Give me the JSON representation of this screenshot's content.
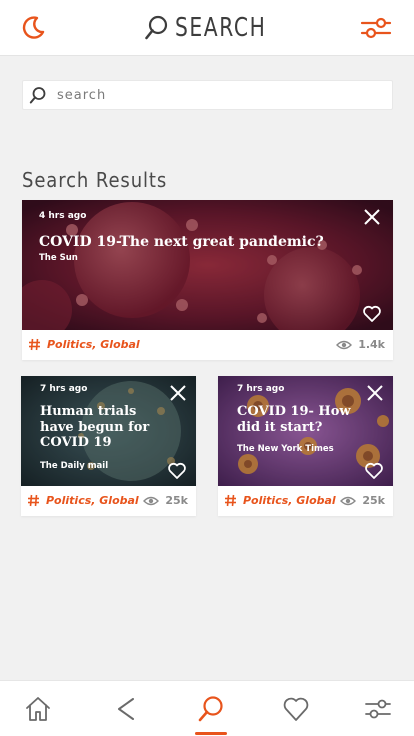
{
  "header": {
    "title": "SEARCH"
  },
  "search": {
    "placeholder": "search"
  },
  "results_title": "Search Results",
  "colors": {
    "accent": "#e8541c",
    "text": "#3d3d3d",
    "background": "#f1f1f1"
  },
  "cards": [
    {
      "time": "4 hrs ago",
      "title": "COVID 19-The next great pandemic?",
      "source": "The Sun",
      "tags": "Politics, Global",
      "views": "1.4k"
    },
    {
      "time": "7 hrs ago",
      "title_lines": [
        "Human trials",
        "have begun for",
        "COVID 19"
      ],
      "source": "The Daily mail",
      "tags": "Politics, Global",
      "views": "25k"
    },
    {
      "time": "7 hrs ago",
      "title_lines": [
        "COVID 19- How",
        "did it start?"
      ],
      "source": "The New York Times",
      "tags": "Politics, Global",
      "views": "25k"
    }
  ],
  "nav": {
    "items": [
      {
        "icon": "home-icon"
      },
      {
        "icon": "share-icon"
      },
      {
        "icon": "search-icon",
        "active": true
      },
      {
        "icon": "heart-icon"
      },
      {
        "icon": "filter-icon"
      }
    ]
  }
}
